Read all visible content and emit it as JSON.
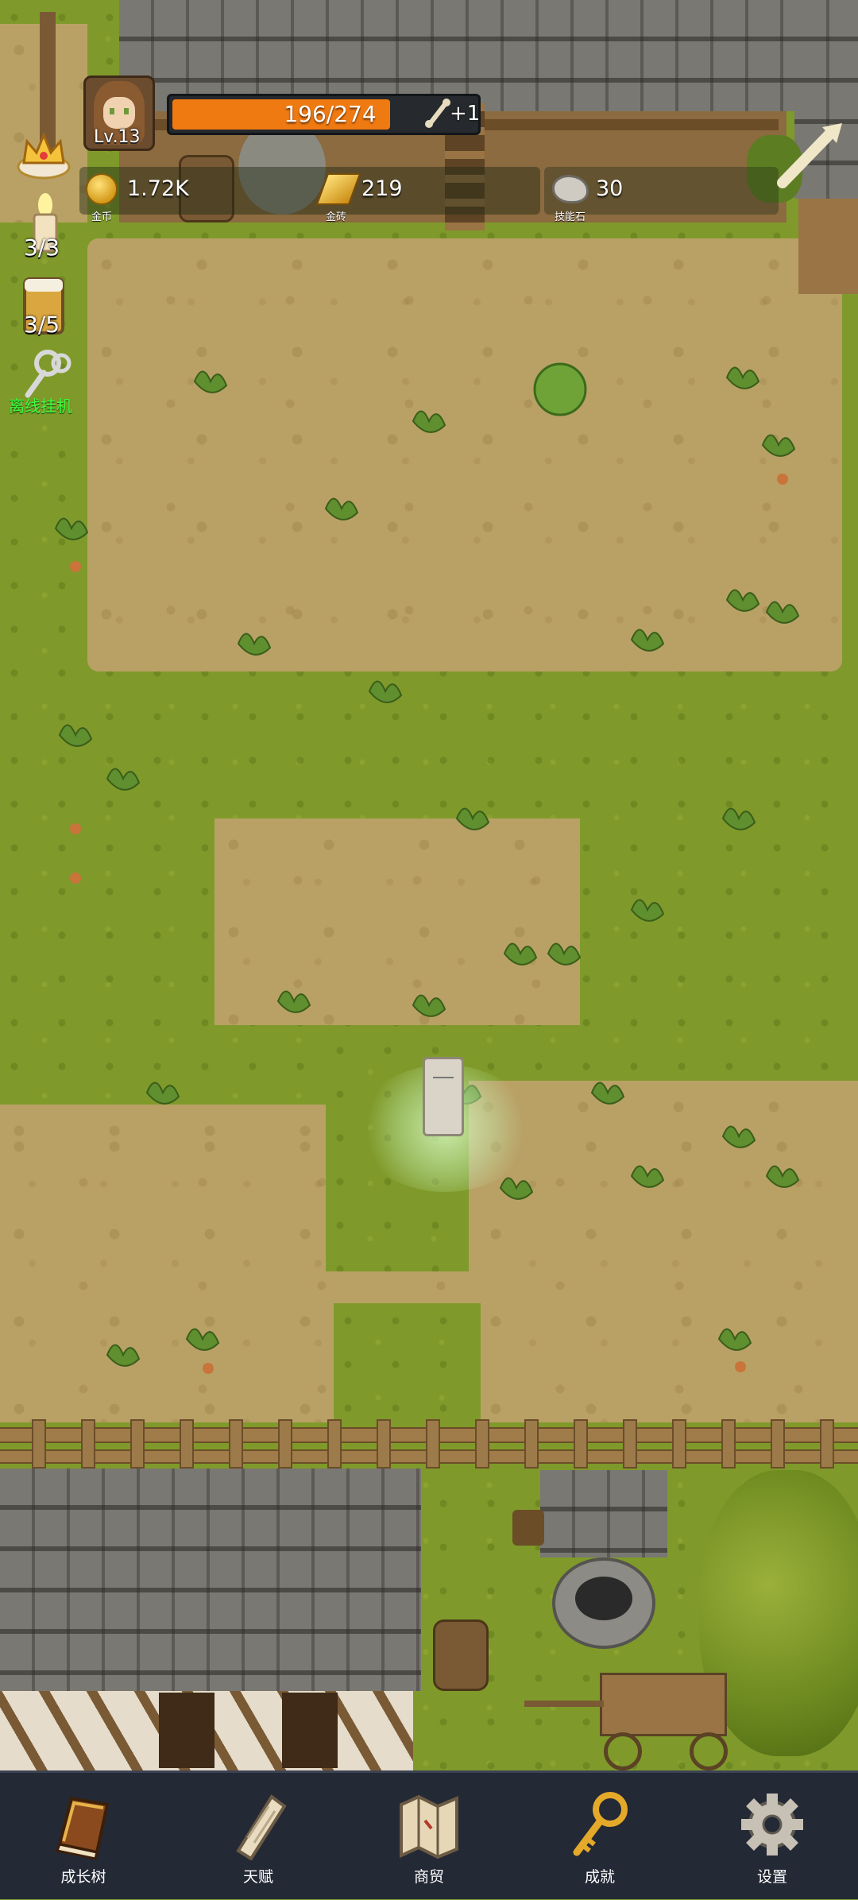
{
  "player": {
    "level": "Lv.13",
    "hp_text": "196/274",
    "hp_fraction": 0.716,
    "bonus": "+1"
  },
  "resources": [
    {
      "icon": "gold-coin-icon",
      "value": "1.72K",
      "label": "金币"
    },
    {
      "icon": "gold-brick-icon",
      "value": "219",
      "label": "金砖"
    },
    {
      "icon": "skill-stone-icon",
      "value": "30",
      "label": "技能石"
    }
  ],
  "side": {
    "candle_count": "3/3",
    "beer_count": "3/5",
    "idle_label": "离线挂机"
  },
  "nav": [
    {
      "label": "成长树",
      "icon": "book-icon"
    },
    {
      "label": "天赋",
      "icon": "scroll-icon"
    },
    {
      "label": "商贸",
      "icon": "map-icon"
    },
    {
      "label": "成就",
      "icon": "key-icon"
    },
    {
      "label": "设置",
      "icon": "gear-icon"
    }
  ],
  "colors": {
    "hp_bar": "#f07a12",
    "grass": "#7f9a2a",
    "dirt": "#b9a166",
    "nav_bg": "#232935",
    "idle_label": "#3dff3d"
  }
}
